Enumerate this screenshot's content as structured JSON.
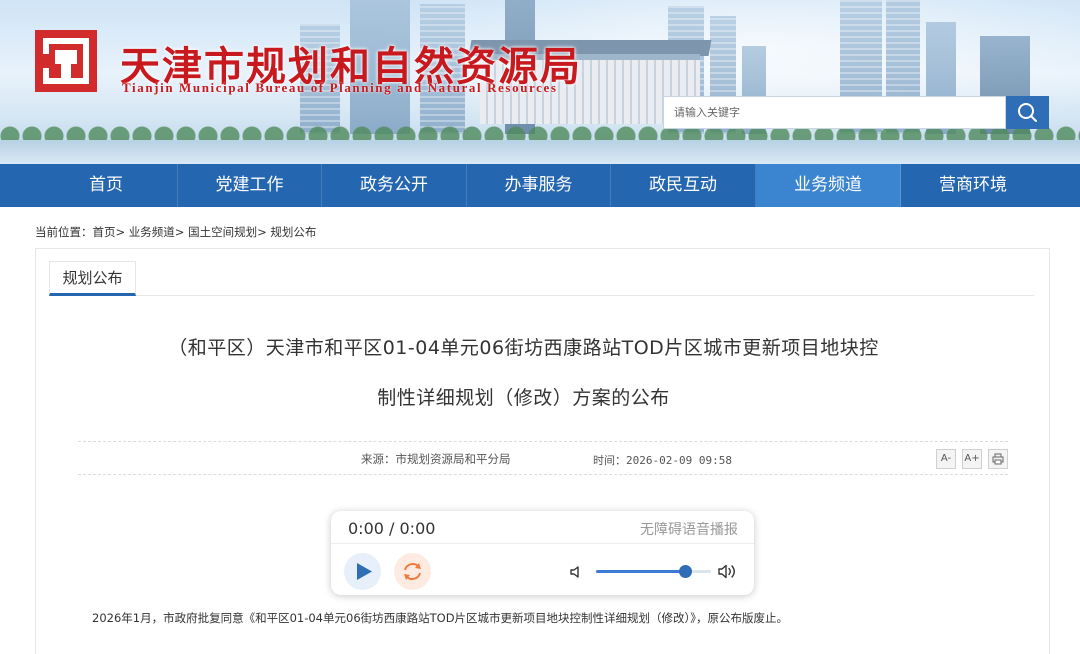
{
  "header": {
    "site_title": "天津市规划和自然资源局",
    "site_subtitle": "Tianjin Municipal Bureau of Planning and Natural Resources",
    "search_placeholder": "请输入关键字",
    "brand_color": "#c8191f"
  },
  "nav": {
    "items": [
      {
        "label": "首页"
      },
      {
        "label": "党建工作"
      },
      {
        "label": "政务公开"
      },
      {
        "label": "办事服务"
      },
      {
        "label": "政民互动"
      },
      {
        "label": "业务频道",
        "active": true
      },
      {
        "label": "营商环境"
      }
    ],
    "color": "#2566b0"
  },
  "breadcrumb": {
    "prefix": "当前位置：",
    "items": [
      "首页",
      "业务频道",
      "国土空间规划",
      "规划公布"
    ],
    "separator": ">"
  },
  "panel": {
    "tab_label": "规划公布"
  },
  "article": {
    "title_line1": "（和平区）天津市和平区01-04单元06街坊西康路站TOD片区城市更新项目地块控",
    "title_line2": "制性详细规划（修改）方案的公布",
    "source": "来源：市规划资源局和平分局",
    "time": "时间：2026-02-09 09:58",
    "font_smaller_label": "A-",
    "font_larger_label": "A+",
    "body": "2026年1月，市政府批复同意《和平区01-04单元06街坊西康路站TOD片区城市更新项目地块控制性详细规划（修改）》，原公布版废止。"
  },
  "player": {
    "time": "0:00 / 0:00",
    "label": "无障碍语音播报",
    "volume_fraction": 0.77
  }
}
